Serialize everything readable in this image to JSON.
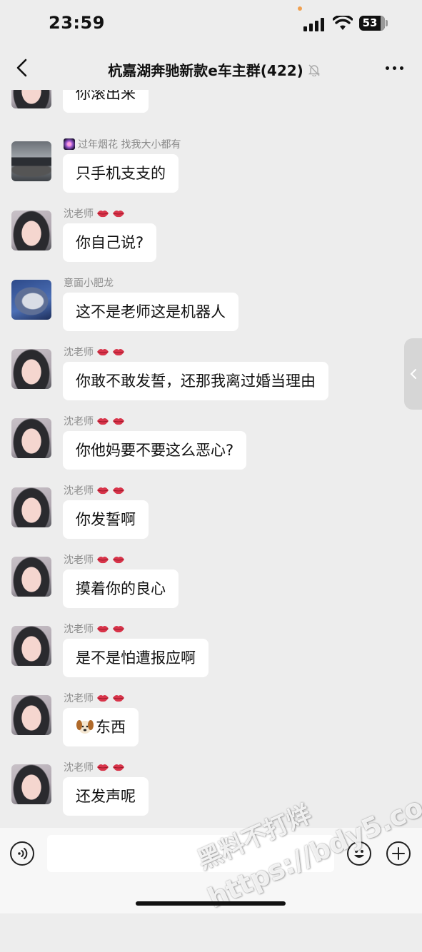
{
  "status_bar": {
    "time": "23:59",
    "battery": "53"
  },
  "header": {
    "title": "杭嘉湖奔驰新款e车主群(422)"
  },
  "messages": [
    {
      "sender": "",
      "avatar": "teacher",
      "text": "你滚出来"
    },
    {
      "sender": "过年烟花 找我大小都有",
      "avatar": "car",
      "text": "只手机支支的"
    },
    {
      "sender": "沈老师",
      "avatar": "teacher",
      "text": "你自己说?"
    },
    {
      "sender": "意面小肥龙",
      "avatar": "shark",
      "text": "这不是老师这是机器人"
    },
    {
      "sender": "沈老师",
      "avatar": "teacher",
      "text": "你敢不敢发誓，还那我离过婚当理由"
    },
    {
      "sender": "沈老师",
      "avatar": "teacher",
      "text": "你他妈要不要这么恶心?"
    },
    {
      "sender": "沈老师",
      "avatar": "teacher",
      "text": "你发誓啊"
    },
    {
      "sender": "沈老师",
      "avatar": "teacher",
      "text": "摸着你的良心"
    },
    {
      "sender": "沈老师",
      "avatar": "teacher",
      "text": "是不是怕遭报应啊"
    },
    {
      "sender": "沈老师",
      "avatar": "teacher",
      "text": "东西",
      "emoji": "dog-face"
    },
    {
      "sender": "沈老师",
      "avatar": "teacher",
      "text": "还发声呢"
    }
  ],
  "input": {
    "value": "",
    "placeholder": ""
  },
  "watermark": {
    "line1": "黑料不打烊",
    "line2": "https://bdy5.co"
  },
  "colors": {
    "background": "#ededed",
    "bubble": "#ffffff",
    "sender_name": "#8a8a8a"
  }
}
